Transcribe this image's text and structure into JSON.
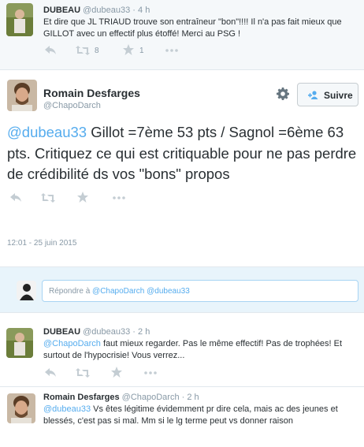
{
  "tweet1": {
    "name": "DUBEAU",
    "handle": "@dubeau33",
    "time": "· 4 h",
    "text": "Et dire que JL TRIAUD trouve son entraîneur \"bon\"!!!! Il n'a pas fait mieux que GILLOT avec un effectif plus étoffé! Merci au PSG !",
    "retweet_count": "8",
    "fav_count": "1"
  },
  "main": {
    "name": "Romain Desfarges",
    "handle": "@ChapoDarch",
    "follow_label": "Suivre",
    "mention": "@dubeau33",
    "text_rest": " Gillot =7ème 53 pts / Sagnol =6ème 63 pts. Critiquez ce qui est critiquable pour ne pas perdre de crédibilité ds vos \"bons\" propos",
    "timestamp": "12:01 - 25 juin 2015"
  },
  "reply_box": {
    "prefix": "Répondre à",
    "mention1": "@ChapoDarch",
    "mention2": "@dubeau33"
  },
  "reply1": {
    "name": "DUBEAU",
    "handle": "@dubeau33",
    "time": "· 2 h",
    "mention": "@ChapoDarch",
    "text_rest": " faut mieux regarder. Pas le même effectif! Pas de trophées! Et surtout de l'hypocrisie! Vous verrez..."
  },
  "reply2": {
    "name": "Romain Desfarges",
    "handle": "@ChapoDarch",
    "time": "· 2 h",
    "mention": "@dubeau33",
    "text_rest": " Vs êtes légitime évidemment pr dire cela, mais ac des jeunes et blessés, c'est pas si mal. Mm si le lg terme peut vs donner raison"
  }
}
